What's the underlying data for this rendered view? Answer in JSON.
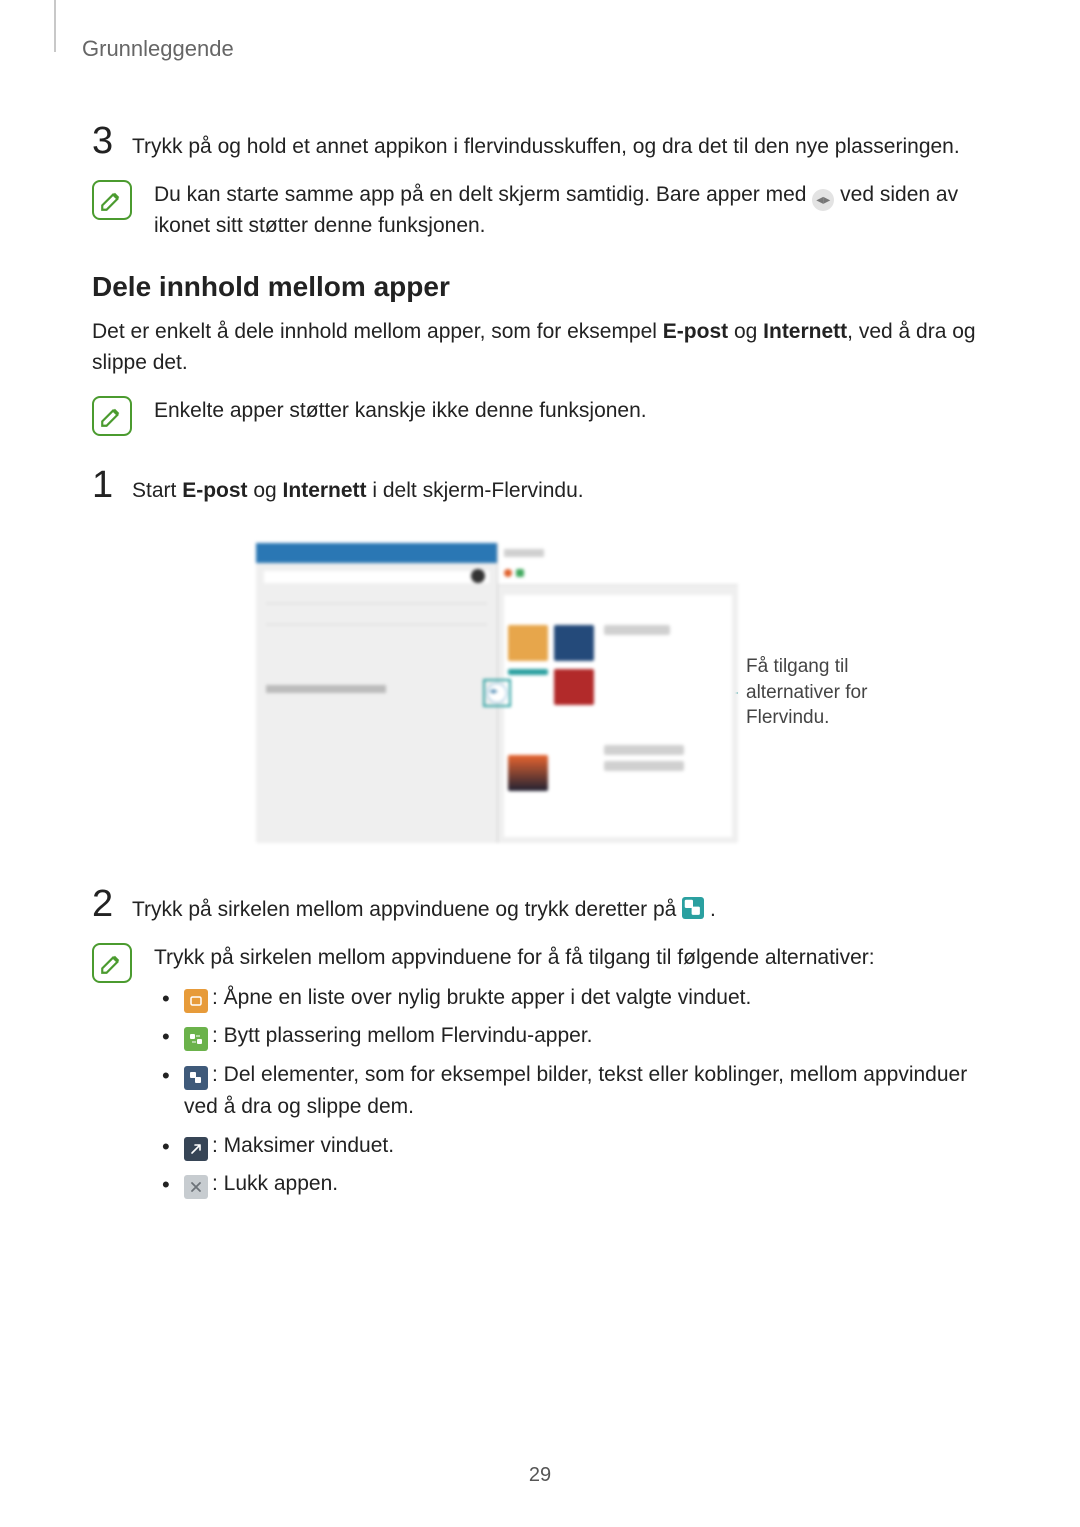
{
  "chapter": "Grunnleggende",
  "page_number": "29",
  "step3": {
    "num": "3",
    "text": "Trykk på og hold et annet appikon i flervindusskuffen, og dra det til den nye plasseringen."
  },
  "note1": {
    "part1": "Du kan starte samme app på en delt skjerm samtidig. Bare apper med ",
    "part2": " ved siden av ikonet sitt støtter denne funksjonen.",
    "icon_name": "multiwindow-support-icon"
  },
  "section_title": "Dele innhold mellom apper",
  "intro": {
    "p1": "Det er enkelt å dele innhold mellom apper, som for eksempel ",
    "b1": "E-post",
    "and": " og ",
    "b2": "Internett",
    "p2": ", ved å dra og slippe det."
  },
  "note2": "Enkelte apper støtter kanskje ikke denne funksjonen.",
  "step1": {
    "num": "1",
    "pre": "Start ",
    "b1": "E-post",
    "and": " og ",
    "b2": "Internett",
    "post": " i delt skjerm-Flervindu."
  },
  "figure_label": "Få tilgang til alternativer for Flervindu.",
  "step2": {
    "num": "2",
    "pre": "Trykk på sirkelen mellom appvinduene og trykk deretter på ",
    "post": ".",
    "icon_name": "drag-share-icon"
  },
  "note3": {
    "lead": "Trykk på sirkelen mellom appvinduene for å få tilgang til følgende alternativer:",
    "options": [
      {
        "icon": "recent-apps-icon",
        "text": ": Åpne en liste over nylig brukte apper i det valgte vinduet."
      },
      {
        "icon": "swap-windows-icon",
        "text": ": Bytt plassering mellom Flervindu-apper."
      },
      {
        "icon": "drag-share-icon",
        "text": ": Del elementer, som for eksempel bilder, tekst eller koblinger, mellom appvinduer ved å dra og slippe dem."
      },
      {
        "icon": "maximize-icon",
        "text": ": Maksimer vinduet."
      },
      {
        "icon": "close-icon",
        "text": ": Lukk appen."
      }
    ]
  }
}
